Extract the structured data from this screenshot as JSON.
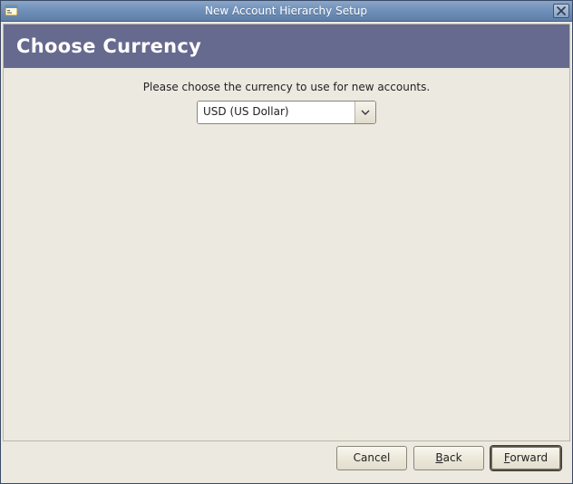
{
  "window": {
    "title": "New Account Hierarchy Setup"
  },
  "header": {
    "title": "Choose Currency"
  },
  "body": {
    "instruction": "Please choose the currency to use for new accounts.",
    "currency_selected": "USD (US Dollar)"
  },
  "buttons": {
    "cancel": "Cancel",
    "back": "Back",
    "forward": "Forward"
  }
}
